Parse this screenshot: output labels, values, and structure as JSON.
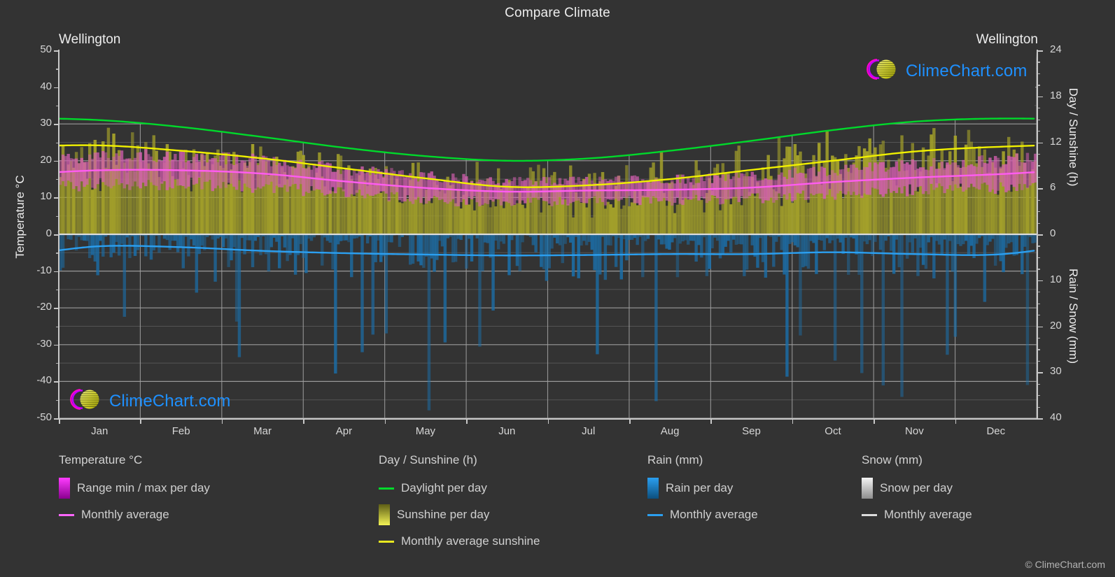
{
  "header": {
    "title": "Compare Climate",
    "station_left": "Wellington",
    "station_right": "Wellington"
  },
  "axes": {
    "left_title": "Temperature °C",
    "right_top_title": "Day / Sunshine (h)",
    "right_bottom_title": "Rain / Snow (mm)",
    "left_ticks": [
      "50",
      "40",
      "30",
      "20",
      "10",
      "0",
      "-10",
      "-20",
      "-30",
      "-40",
      "-50"
    ],
    "right_top_ticks": [
      "24",
      "18",
      "12",
      "6",
      "0"
    ],
    "right_bottom_ticks": [
      "10",
      "20",
      "30",
      "40"
    ],
    "x_ticks": [
      "Jan",
      "Feb",
      "Mar",
      "Apr",
      "May",
      "Jun",
      "Jul",
      "Aug",
      "Sep",
      "Oct",
      "Nov",
      "Dec"
    ]
  },
  "watermark": {
    "text": "ClimeChart.com"
  },
  "legend": {
    "groups": [
      {
        "title": "Temperature °C",
        "items": [
          {
            "label": "Range min / max per day",
            "marker": "box",
            "color": "#ff00ff"
          },
          {
            "label": "Monthly average",
            "marker": "line",
            "color": "#ff66ff"
          }
        ]
      },
      {
        "title": "Day / Sunshine (h)",
        "items": [
          {
            "label": "Daylight per day",
            "marker": "line",
            "color": "#00d92b"
          },
          {
            "label": "Sunshine per day",
            "marker": "box",
            "color": "#eaea33"
          },
          {
            "label": "Monthly average sunshine",
            "marker": "line",
            "color": "#e8e820"
          }
        ]
      },
      {
        "title": "Rain (mm)",
        "items": [
          {
            "label": "Rain per day",
            "marker": "box",
            "color": "#1e8fe0"
          },
          {
            "label": "Monthly average",
            "marker": "line",
            "color": "#2b9ff0"
          }
        ]
      },
      {
        "title": "Snow (mm)",
        "items": [
          {
            "label": "Snow per day",
            "marker": "box",
            "color": "#e8e8e8"
          },
          {
            "label": "Monthly average",
            "marker": "line",
            "color": "#dcdcdc"
          }
        ]
      }
    ],
    "copyright": "© ClimeChart.com"
  },
  "colors": {
    "background": "#333333",
    "grid": "#9a9a9a",
    "axis": "#c8c8c8",
    "daylight": "#00d92b",
    "sunshine_line": "#f0f000",
    "sunshine_fill": "#a3a02a",
    "temp_range": "#d45fb0",
    "temp_avg": "#ff5cf0",
    "rain_fill": "#1b6ea8",
    "rain_avg": "#2b9ff0",
    "night": "#2b2b2b",
    "text": "#e0e0e0"
  },
  "chart_data": {
    "type": "line",
    "title": "Compare Climate",
    "subtitle": "Wellington",
    "xlabel": "",
    "ylabel": "Temperature °C",
    "y2label_top": "Day / Sunshine (h)",
    "y2label_bottom": "Rain / Snow (mm)",
    "ylim": [
      -50,
      50
    ],
    "y2lim_day": [
      0,
      24
    ],
    "y2lim_rain": [
      0,
      40
    ],
    "grid": true,
    "legend_position": "below",
    "categories": [
      "Jan",
      "Feb",
      "Mar",
      "Apr",
      "May",
      "Jun",
      "Jul",
      "Aug",
      "Sep",
      "Oct",
      "Nov",
      "Dec"
    ],
    "series": [
      {
        "name": "Daylight per day",
        "unit": "h",
        "axis": "right-day",
        "color": "#00d92b",
        "values": [
          14.9,
          14.0,
          12.7,
          11.3,
          10.2,
          9.6,
          9.9,
          10.9,
          12.2,
          13.6,
          14.7,
          15.1
        ]
      },
      {
        "name": "Monthly average sunshine",
        "unit": "h",
        "axis": "right-day",
        "color": "#f0f000",
        "values": [
          11.6,
          10.9,
          9.9,
          8.6,
          7.3,
          6.2,
          6.4,
          7.2,
          8.4,
          9.6,
          10.8,
          11.4
        ]
      },
      {
        "name": "Temperature monthly average",
        "unit": "°C",
        "axis": "left",
        "color": "#ff5cf0",
        "values": [
          17.4,
          17.4,
          16.5,
          14.4,
          12.6,
          11.6,
          11.9,
          12.1,
          12.7,
          14.2,
          15.4,
          16.3
        ]
      },
      {
        "name": "Temperature range max per day",
        "unit": "°C",
        "axis": "left",
        "color": "#d45fb0",
        "values": [
          20.6,
          20.6,
          19.5,
          17.2,
          15.2,
          14.0,
          14.2,
          14.5,
          15.4,
          16.9,
          18.3,
          19.5
        ]
      },
      {
        "name": "Temperature range min per day",
        "unit": "°C",
        "axis": "left",
        "color": "#d45fb0",
        "values": [
          14.1,
          14.2,
          13.4,
          11.5,
          9.9,
          9.1,
          9.5,
          9.6,
          10.1,
          11.4,
          12.5,
          13.2
        ]
      },
      {
        "name": "Rain monthly average",
        "unit": "mm",
        "axis": "right-rain",
        "color": "#2b9ff0",
        "values": [
          2.6,
          2.8,
          3.6,
          4.1,
          4.4,
          4.6,
          4.5,
          4.3,
          4.3,
          3.9,
          4.3,
          4.4
        ]
      },
      {
        "name": "Snow monthly average",
        "unit": "mm",
        "axis": "right-rain",
        "color": "#dcdcdc",
        "values": [
          0,
          0,
          0,
          0,
          0,
          0,
          0,
          0,
          0,
          0,
          0,
          0
        ]
      }
    ]
  }
}
